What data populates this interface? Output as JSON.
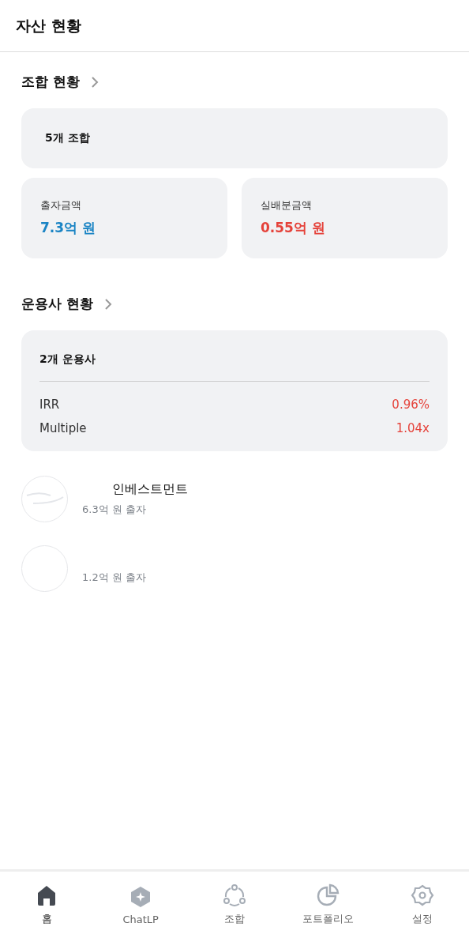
{
  "header": {
    "title": "자산 현황"
  },
  "fund_section": {
    "title": "조합 현황",
    "summary": "5개 조합",
    "stats": [
      {
        "label": "출자금액",
        "value": "7.3억 원",
        "color": "#1a84c4"
      },
      {
        "label": "실배분금액",
        "value": "0.55억 원",
        "color": "#e5423a"
      }
    ]
  },
  "manager_section": {
    "title": "운용사 현황",
    "summary": "2개 운용사",
    "metrics": [
      {
        "label": "IRR",
        "value": "0.96%"
      },
      {
        "label": "Multiple",
        "value": "1.04x"
      }
    ]
  },
  "managers": [
    {
      "name": "인베스트먼트",
      "amount": "6.3억 원 출자",
      "logo": true
    },
    {
      "amount": "1.2억 원 출자",
      "logo": false
    }
  ],
  "nav": [
    {
      "label": "홈",
      "kind": "home",
      "selected": true
    },
    {
      "label": "ChatLP",
      "kind": "chat",
      "selected": false
    },
    {
      "label": "조합",
      "kind": "fund",
      "selected": false
    },
    {
      "label": "포트폴리오",
      "kind": "portfolio",
      "selected": false
    },
    {
      "label": "설정",
      "kind": "settings",
      "selected": false
    }
  ]
}
